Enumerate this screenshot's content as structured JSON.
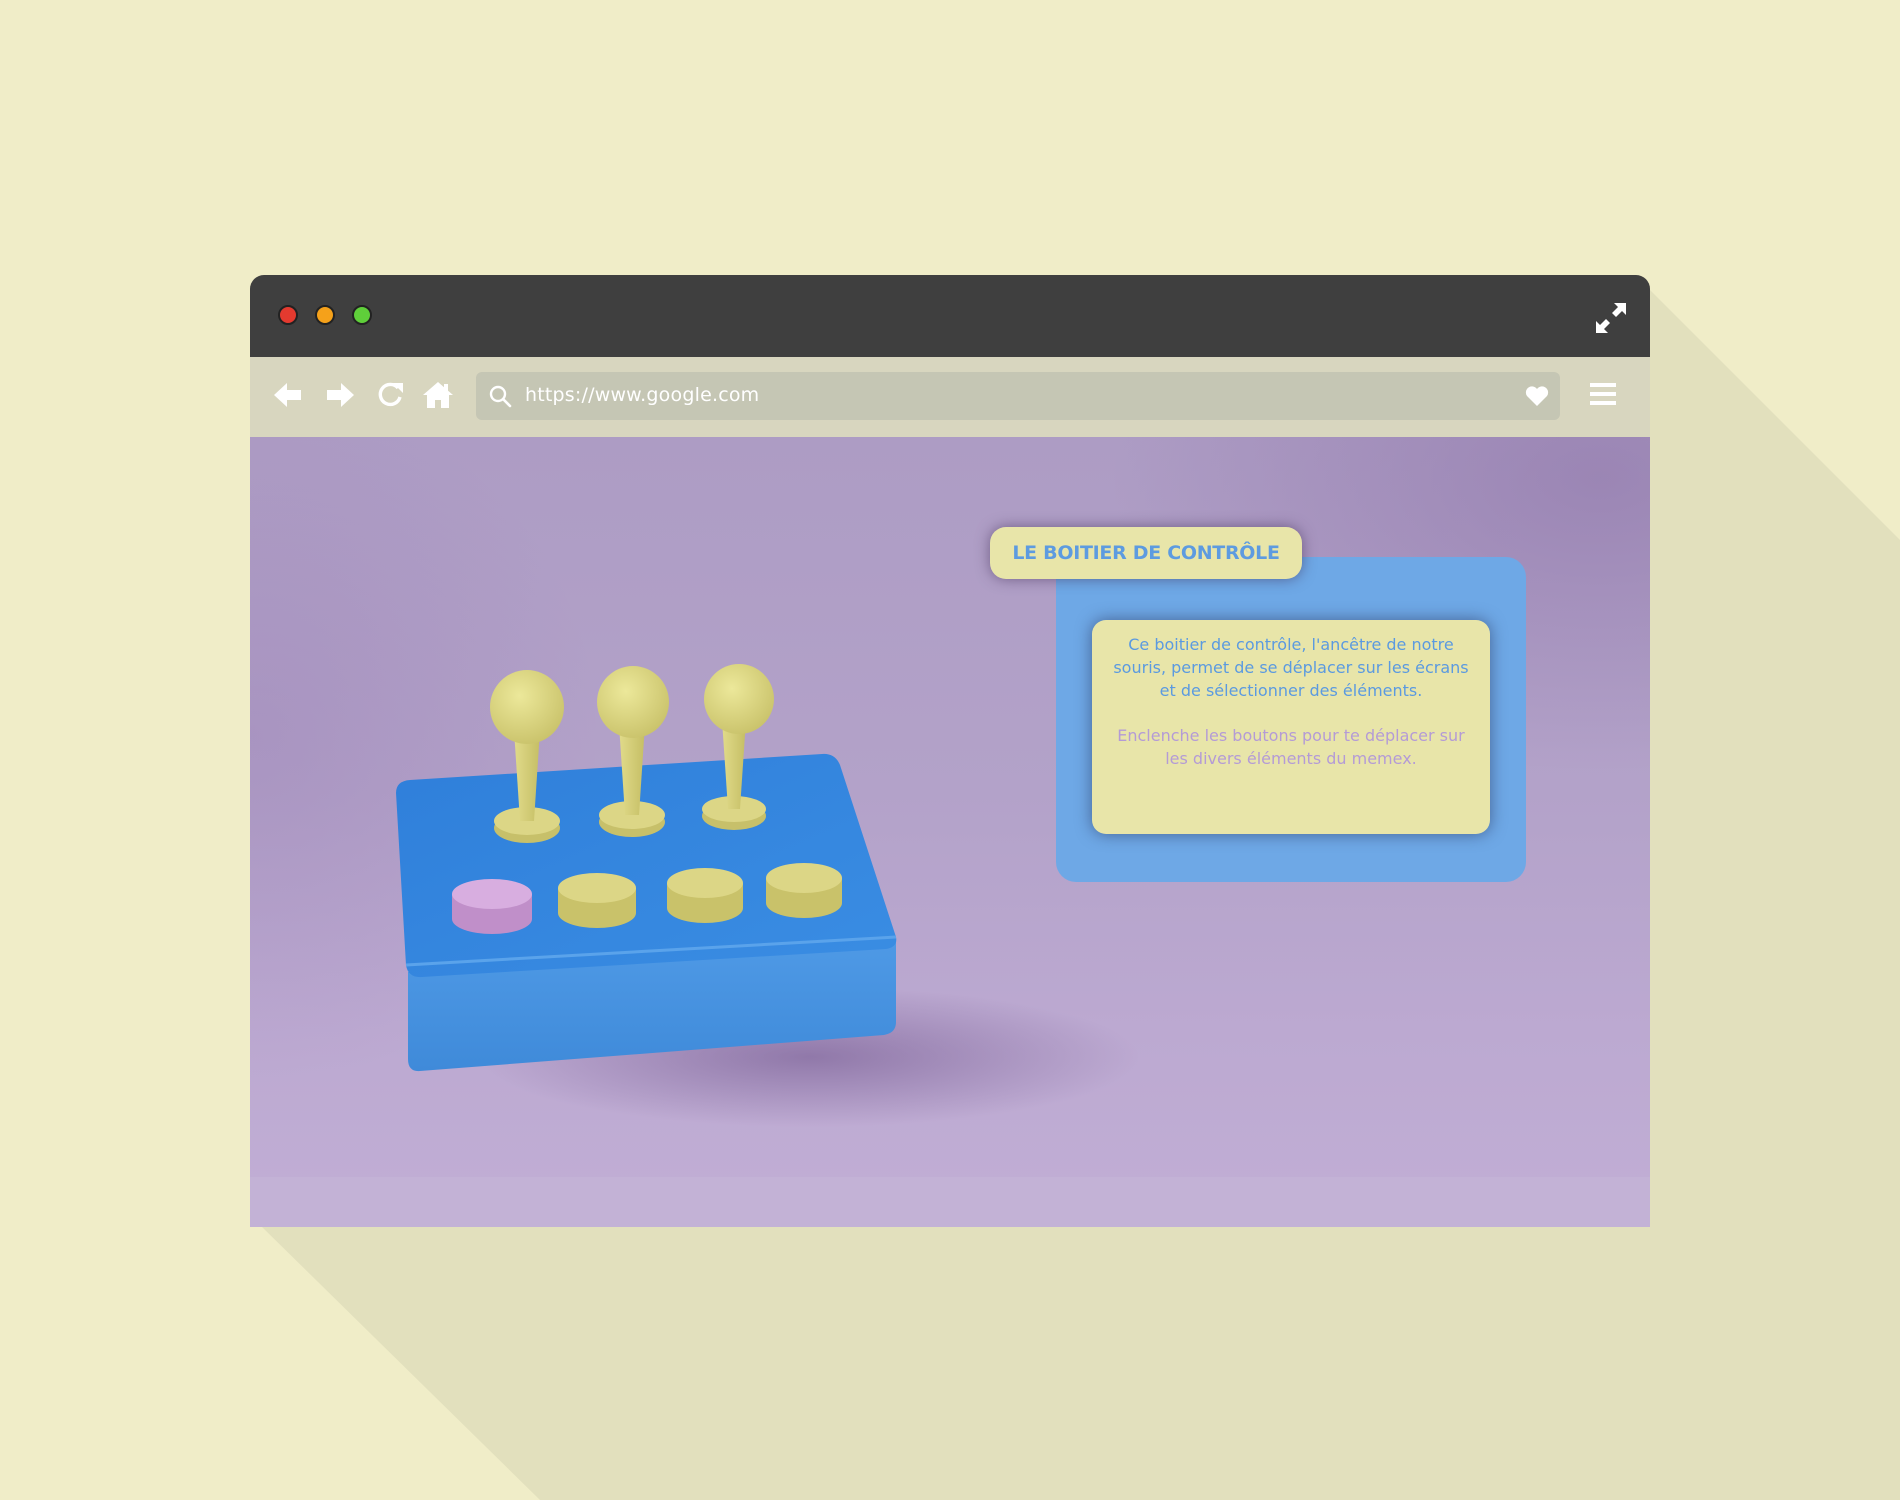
{
  "window": {
    "controls": [
      "close",
      "minimize",
      "maximize"
    ],
    "expand_icon": "expand-arrows-icon"
  },
  "navbar": {
    "back_icon": "arrow-left-icon",
    "forward_icon": "arrow-right-icon",
    "reload_icon": "reload-icon",
    "home_icon": "home-icon",
    "url": "https://www.google.com",
    "favorite_icon": "heart-icon",
    "menu_icon": "hamburger-menu-icon"
  },
  "content": {
    "title": "LE BOITIER DE CONTRÔLE",
    "description": "Ce boitier de contrôle, l'ancêtre de notre souris, permet de se déplacer sur les écrans et de sélectionner des éléments.",
    "instruction": "Enclenche les boutons pour te déplacer sur les divers éléments du memex."
  },
  "colors": {
    "page_background": "#f0edc8",
    "titlebar": "#3f3f3f",
    "navbar": "#d8d6bf",
    "urlbar": "#c5c6b4",
    "viewport": "#b3a2c9",
    "device_body": "#3e8fe0",
    "knob": "#d8d27e",
    "selected_button": "#d6a8dc",
    "panel_back": "#6ea8e6",
    "card": "#e8e5a9",
    "title_text": "#5d9be0",
    "instruction_text": "#b49bd6"
  }
}
